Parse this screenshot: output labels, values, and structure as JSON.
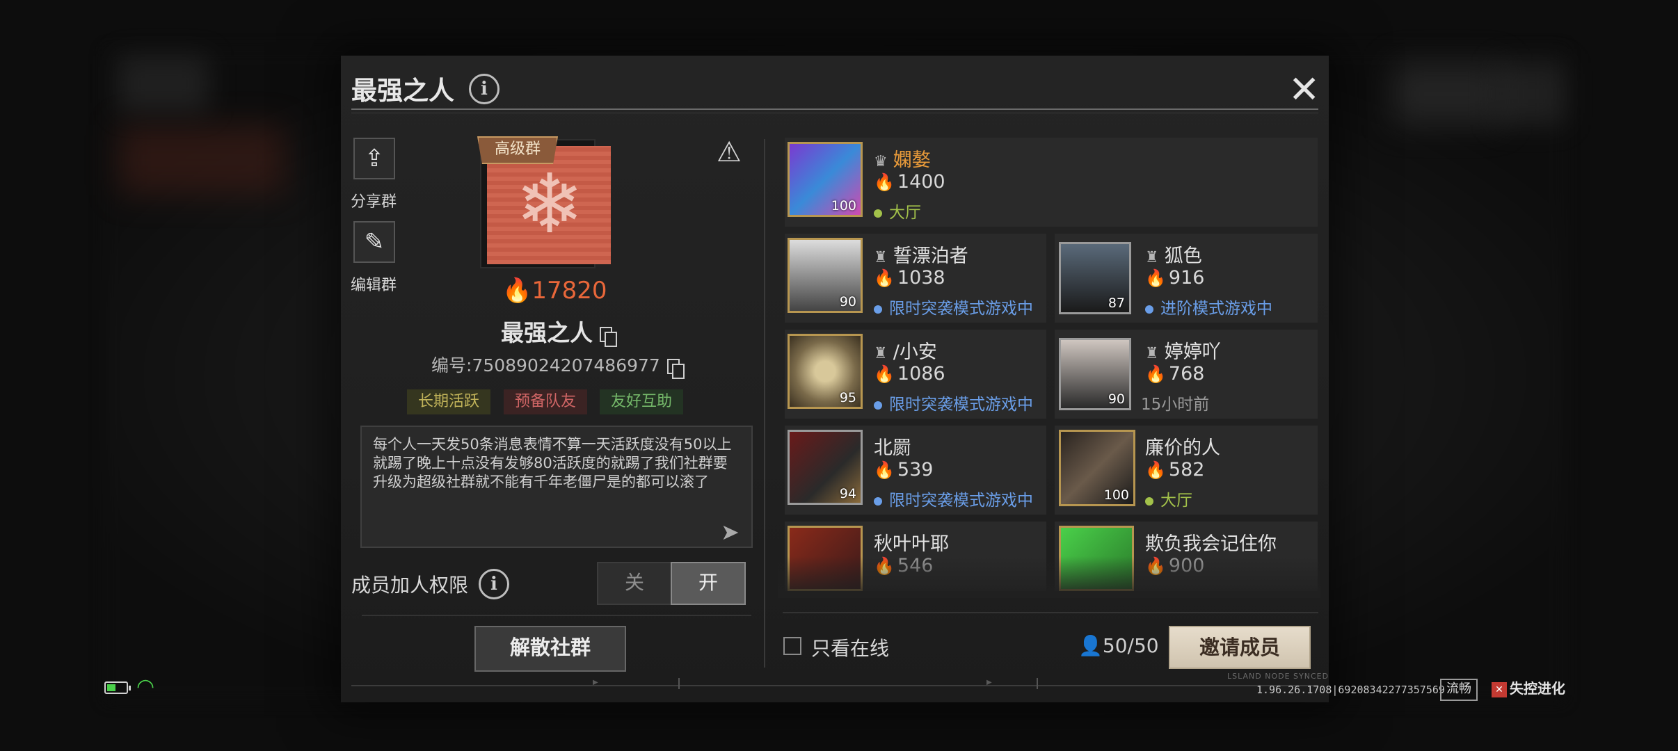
{
  "dialog": {
    "title": "最强之人",
    "share_label": "分享群",
    "edit_label": "编辑群"
  },
  "group": {
    "badge": "高级群",
    "heat": "17820",
    "name": "最强之人",
    "id_text": "编号:7508902420748697​7",
    "tags": [
      "长期活跃",
      "预备队友",
      "友好互助"
    ],
    "description": "每个人一天发50条消息表情不算一天活跃度没有50以上就踢了晚上十点没有发够80活跃度的就踢了我们社群要升级为超级社群就不能有千年老僵尸是的都可以滚了"
  },
  "permission": {
    "label": "成员加人权限",
    "off": "关",
    "on": "开",
    "value": "开"
  },
  "actions": {
    "dissolve": "解散社群",
    "invite": "邀请成员",
    "online_only": "只看在线",
    "member_count": "50/50"
  },
  "members": [
    {
      "name": "嫻嫯",
      "score": "1400",
      "level": "100",
      "status": "大厅",
      "status_type": "green",
      "owner": true
    },
    {
      "name": "誓漂泊者",
      "score": "1038",
      "level": "90",
      "status": "限时突袭模式游戏中",
      "status_type": "blue"
    },
    {
      "name": "狐色",
      "score": "916",
      "level": "87",
      "status": "进阶模式游戏中",
      "status_type": "blue"
    },
    {
      "name": "/小安",
      "score": "1086",
      "level": "95",
      "status": "限时突袭模式游戏中",
      "status_type": "blue"
    },
    {
      "name": "婷婷吖",
      "score": "768",
      "level": "90",
      "status": "15小时前",
      "status_type": "gray"
    },
    {
      "name": "北罽",
      "score": "539",
      "level": "94",
      "status": "限时突袭模式游戏中",
      "status_type": "blue"
    },
    {
      "name": "廉价的人",
      "score": "582",
      "level": "100",
      "status": "大厅",
      "status_type": "green"
    },
    {
      "name": "秋叶叶耶",
      "score": "546",
      "level": "",
      "status": "",
      "status_type": "gray"
    },
    {
      "name": "欺负我会记住你",
      "score": "900",
      "level": "",
      "status": "",
      "status_type": "gray"
    }
  ],
  "footer": {
    "version": "1.96.26.1708|69208342277357569",
    "smooth": "流畅",
    "logo": "失控进化",
    "sync": "LSLAND NODE SYNCED"
  },
  "colors": {
    "accent_orange": "#e8673a",
    "status_blue": "#6a9ee8",
    "status_green": "#a3c24a",
    "invite_bg": "#e7ddcc"
  }
}
